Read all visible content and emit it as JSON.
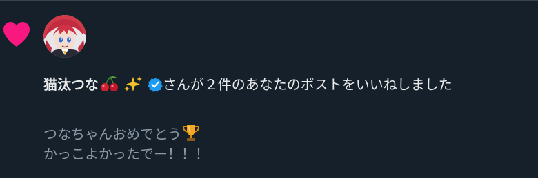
{
  "notification": {
    "type_icon": "heart-icon",
    "avatar_icon": "avatar",
    "user_name": "猫汰つな",
    "name_emojis": [
      "cherries-icon",
      "sparkles-icon"
    ],
    "verified_icon": "verified-badge-icon",
    "action_text": "さんが２件のあなたのポストをいいねしました",
    "quote_lines": [
      "つなちゃんおめでとう",
      "かっこよかったでー！！！"
    ],
    "quote_emoji": "trophy-icon"
  },
  "colors": {
    "background": "#15202b",
    "heart": "#f91880",
    "verified": "#1d9bf0",
    "text_primary": "#e7e9ea",
    "text_secondary": "#8b98a5"
  }
}
